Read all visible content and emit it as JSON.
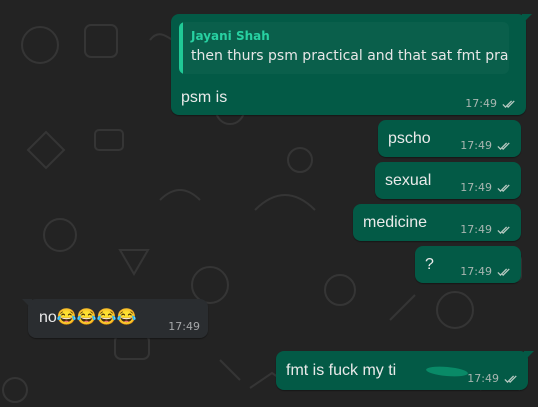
{
  "colors": {
    "outgoing_bubble": "#035a46",
    "incoming_bubble": "#2a2d30",
    "quote_accent": "#20c996",
    "read_ticks": "#b6c9c1"
  },
  "messages": [
    {
      "direction": "outgoing",
      "reply": {
        "name": "Jayani Shah",
        "text": "then thurs psm practical and that sat fmt prac"
      },
      "text": "psm is",
      "time": "17:49",
      "status": "read"
    },
    {
      "direction": "outgoing",
      "text": "pscho",
      "time": "17:49",
      "status": "read"
    },
    {
      "direction": "outgoing",
      "text": "sexual",
      "time": "17:49",
      "status": "read"
    },
    {
      "direction": "outgoing",
      "text": "medicine",
      "time": "17:49",
      "status": "read"
    },
    {
      "direction": "outgoing",
      "text": "?",
      "time": "17:49",
      "status": "read"
    },
    {
      "direction": "incoming",
      "text": "no😂😂😂😂",
      "time": "17:49"
    },
    {
      "direction": "outgoing",
      "text": "fmt is fuck my ti",
      "time": "17:49",
      "status": "read",
      "scribble": "teal scribble over end of text"
    }
  ]
}
